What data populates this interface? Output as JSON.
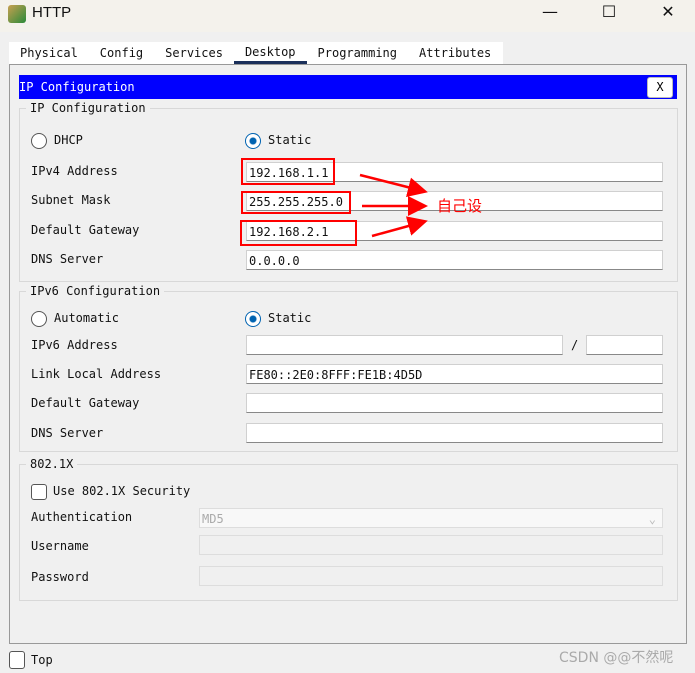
{
  "window": {
    "title": "HTTP",
    "minimize": "—",
    "maximize": "☐",
    "close": "✕"
  },
  "tabs": [
    "Physical",
    "Config",
    "Services",
    "Desktop",
    "Programming",
    "Attributes"
  ],
  "header": {
    "title": "IP Configuration",
    "close": "X"
  },
  "ipv4": {
    "group": "IP Configuration",
    "dhcp": "DHCP",
    "static": "Static",
    "mode": "Static",
    "ipv4_label": "IPv4 Address",
    "ipv4": "192.168.1.1",
    "mask_label": "Subnet Mask",
    "mask": "255.255.255.0",
    "gw_label": "Default Gateway",
    "gw": "192.168.2.1",
    "dns_label": "DNS Server",
    "dns": "0.0.0.0"
  },
  "ipv6": {
    "group": "IPv6 Configuration",
    "auto": "Automatic",
    "static": "Static",
    "mode": "Static",
    "addr_label": "IPv6 Address",
    "addr": "",
    "slash": "/",
    "prefix": "",
    "ll_label": "Link Local Address",
    "ll": "FE80::2E0:8FFF:FE1B:4D5D",
    "gw_label": "Default Gateway",
    "gw": "",
    "dns_label": "DNS Server",
    "dns": ""
  },
  "dot1x": {
    "group": "802.1X",
    "use": "Use 802.1X Security",
    "auth_label": "Authentication",
    "auth": "MD5",
    "user_label": "Username",
    "pass_label": "Password"
  },
  "footer": {
    "top": "Top",
    "watermark": "CSDN @@不然呢"
  },
  "annotation": {
    "text": "自己设",
    "color": "#ff0000"
  }
}
